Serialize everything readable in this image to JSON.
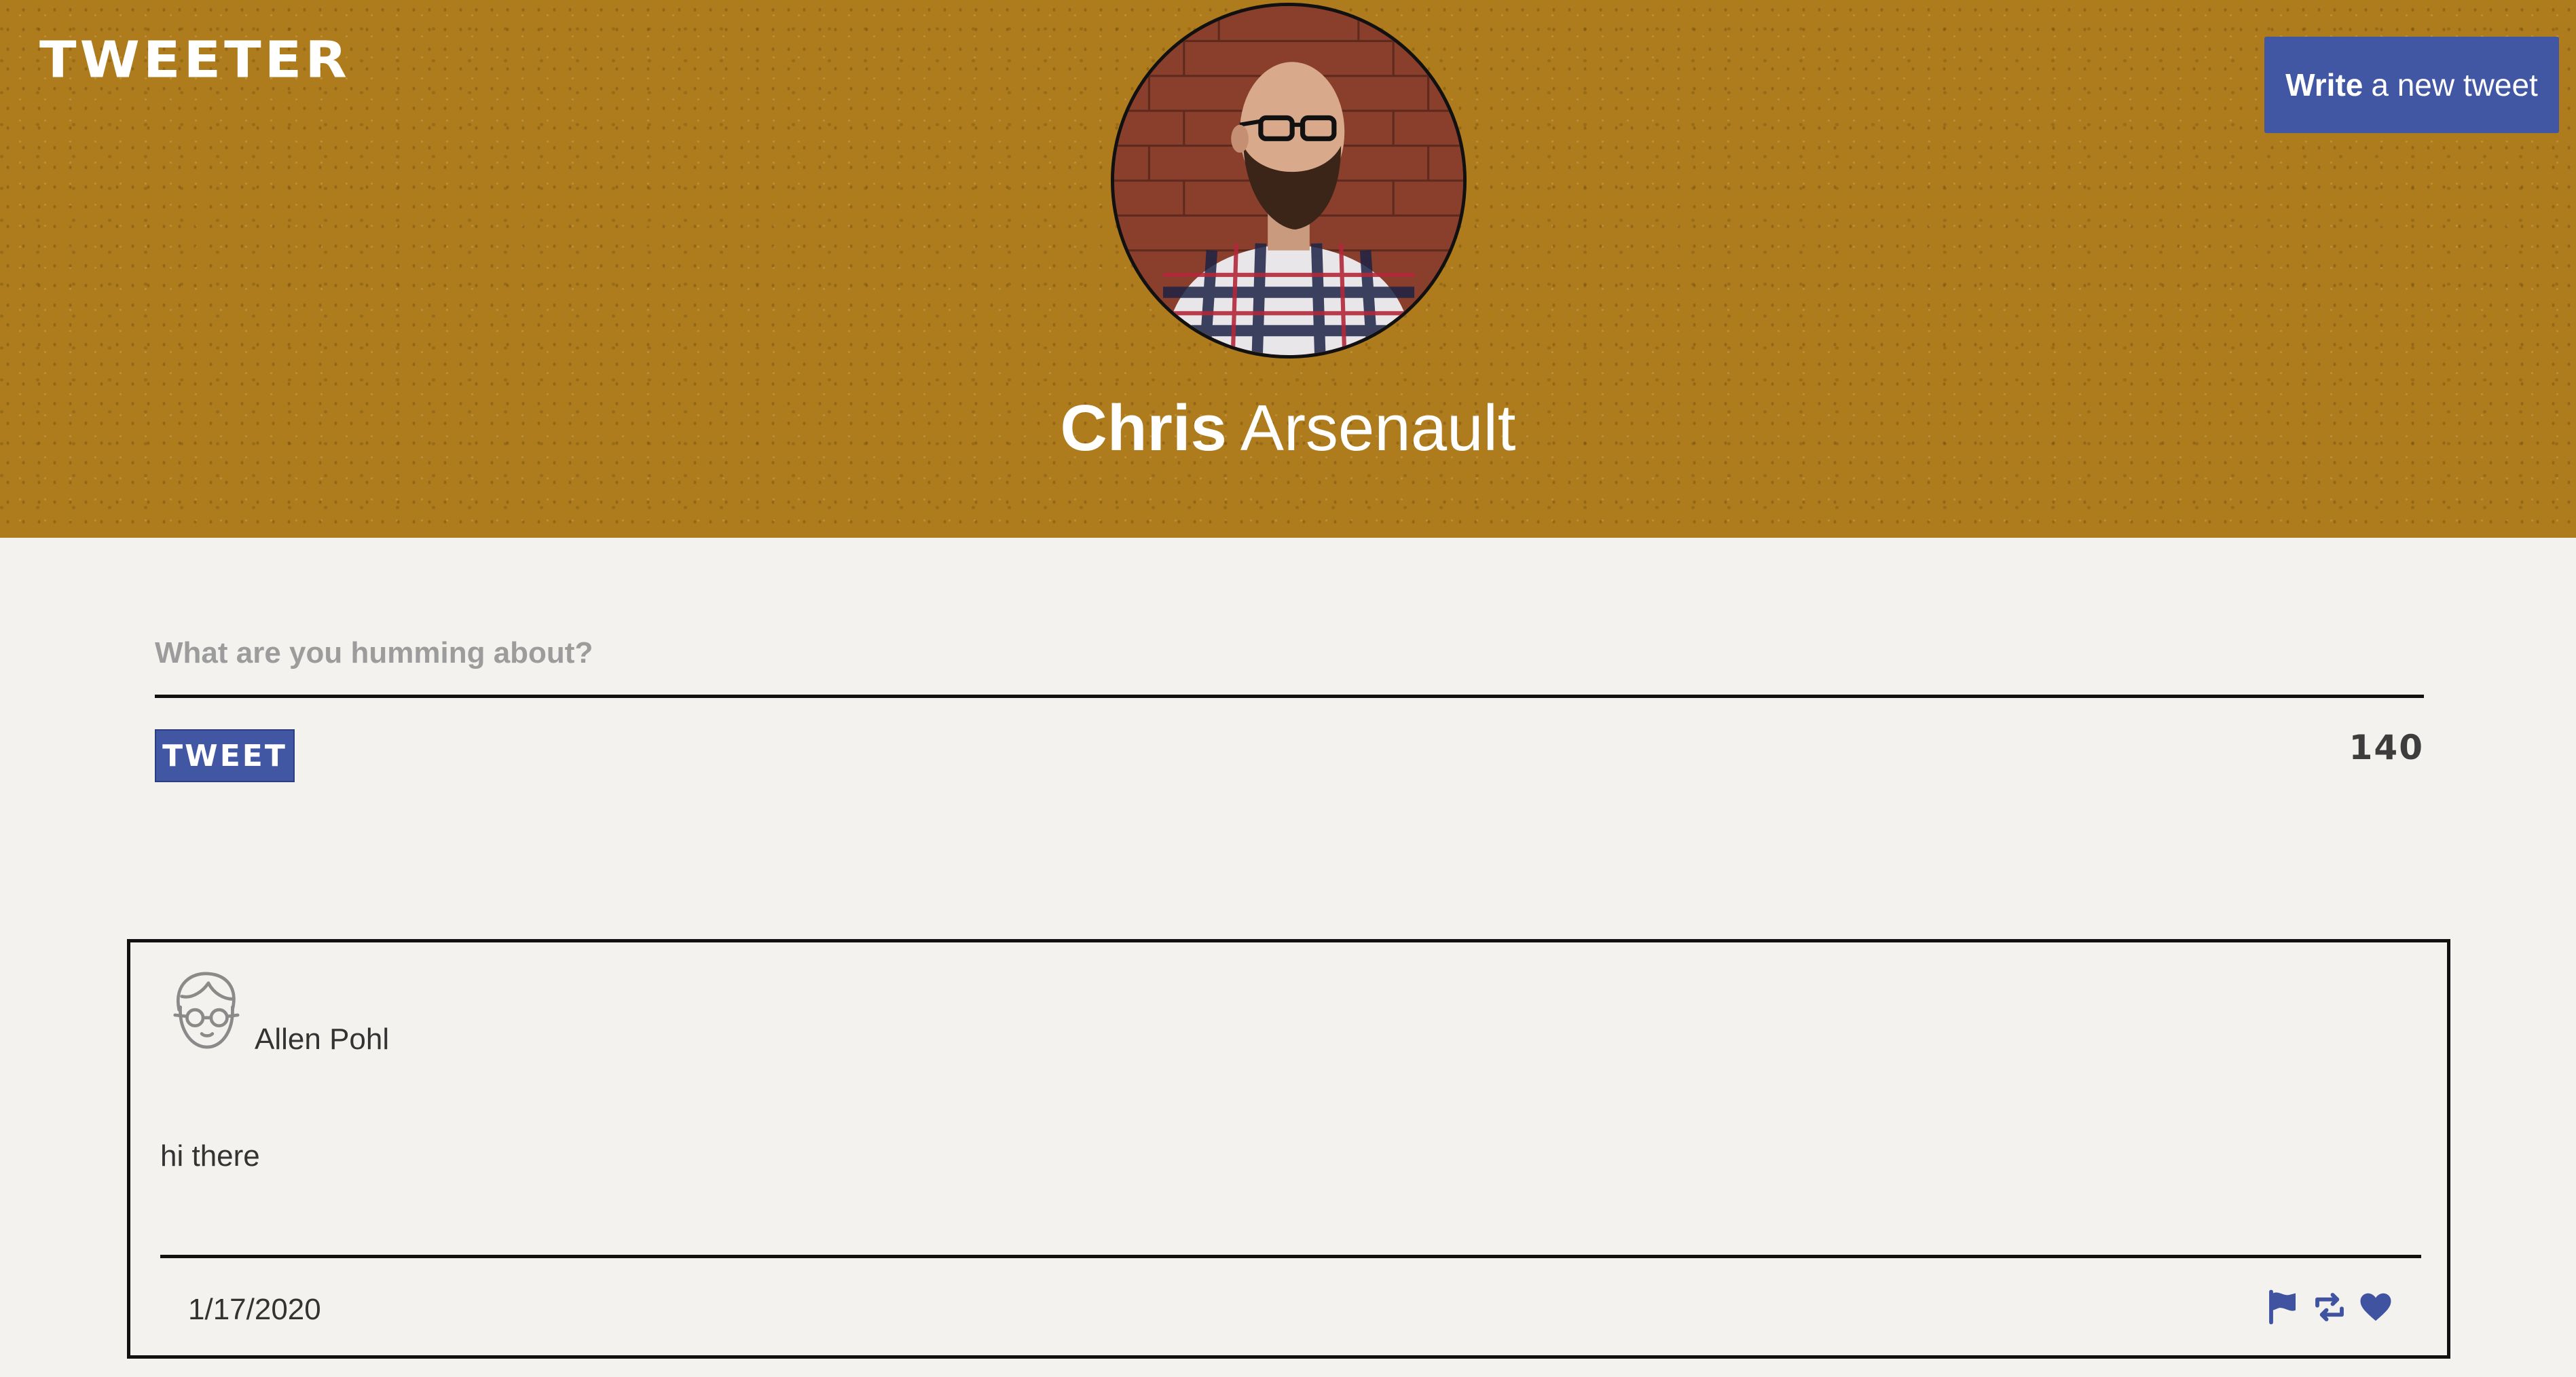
{
  "header": {
    "brand": "TWEETER",
    "write_button": {
      "bold": "Write",
      "rest": "a new tweet"
    },
    "profile": {
      "first_name": "Chris",
      "last_name": "Arsenault"
    }
  },
  "compose": {
    "placeholder": "What are you humming about?",
    "value": "",
    "submit_label": "TWEET",
    "char_count": "140"
  },
  "tweets": [
    {
      "author": "Allen Pohl",
      "body": "hi there",
      "date": "1/17/2020",
      "actions": [
        "flag-icon",
        "retweet-icon",
        "heart-icon"
      ]
    }
  ],
  "colors": {
    "header_bg": "#ae7b1d",
    "accent": "#4257a4",
    "page_bg": "#f4f2ee"
  }
}
